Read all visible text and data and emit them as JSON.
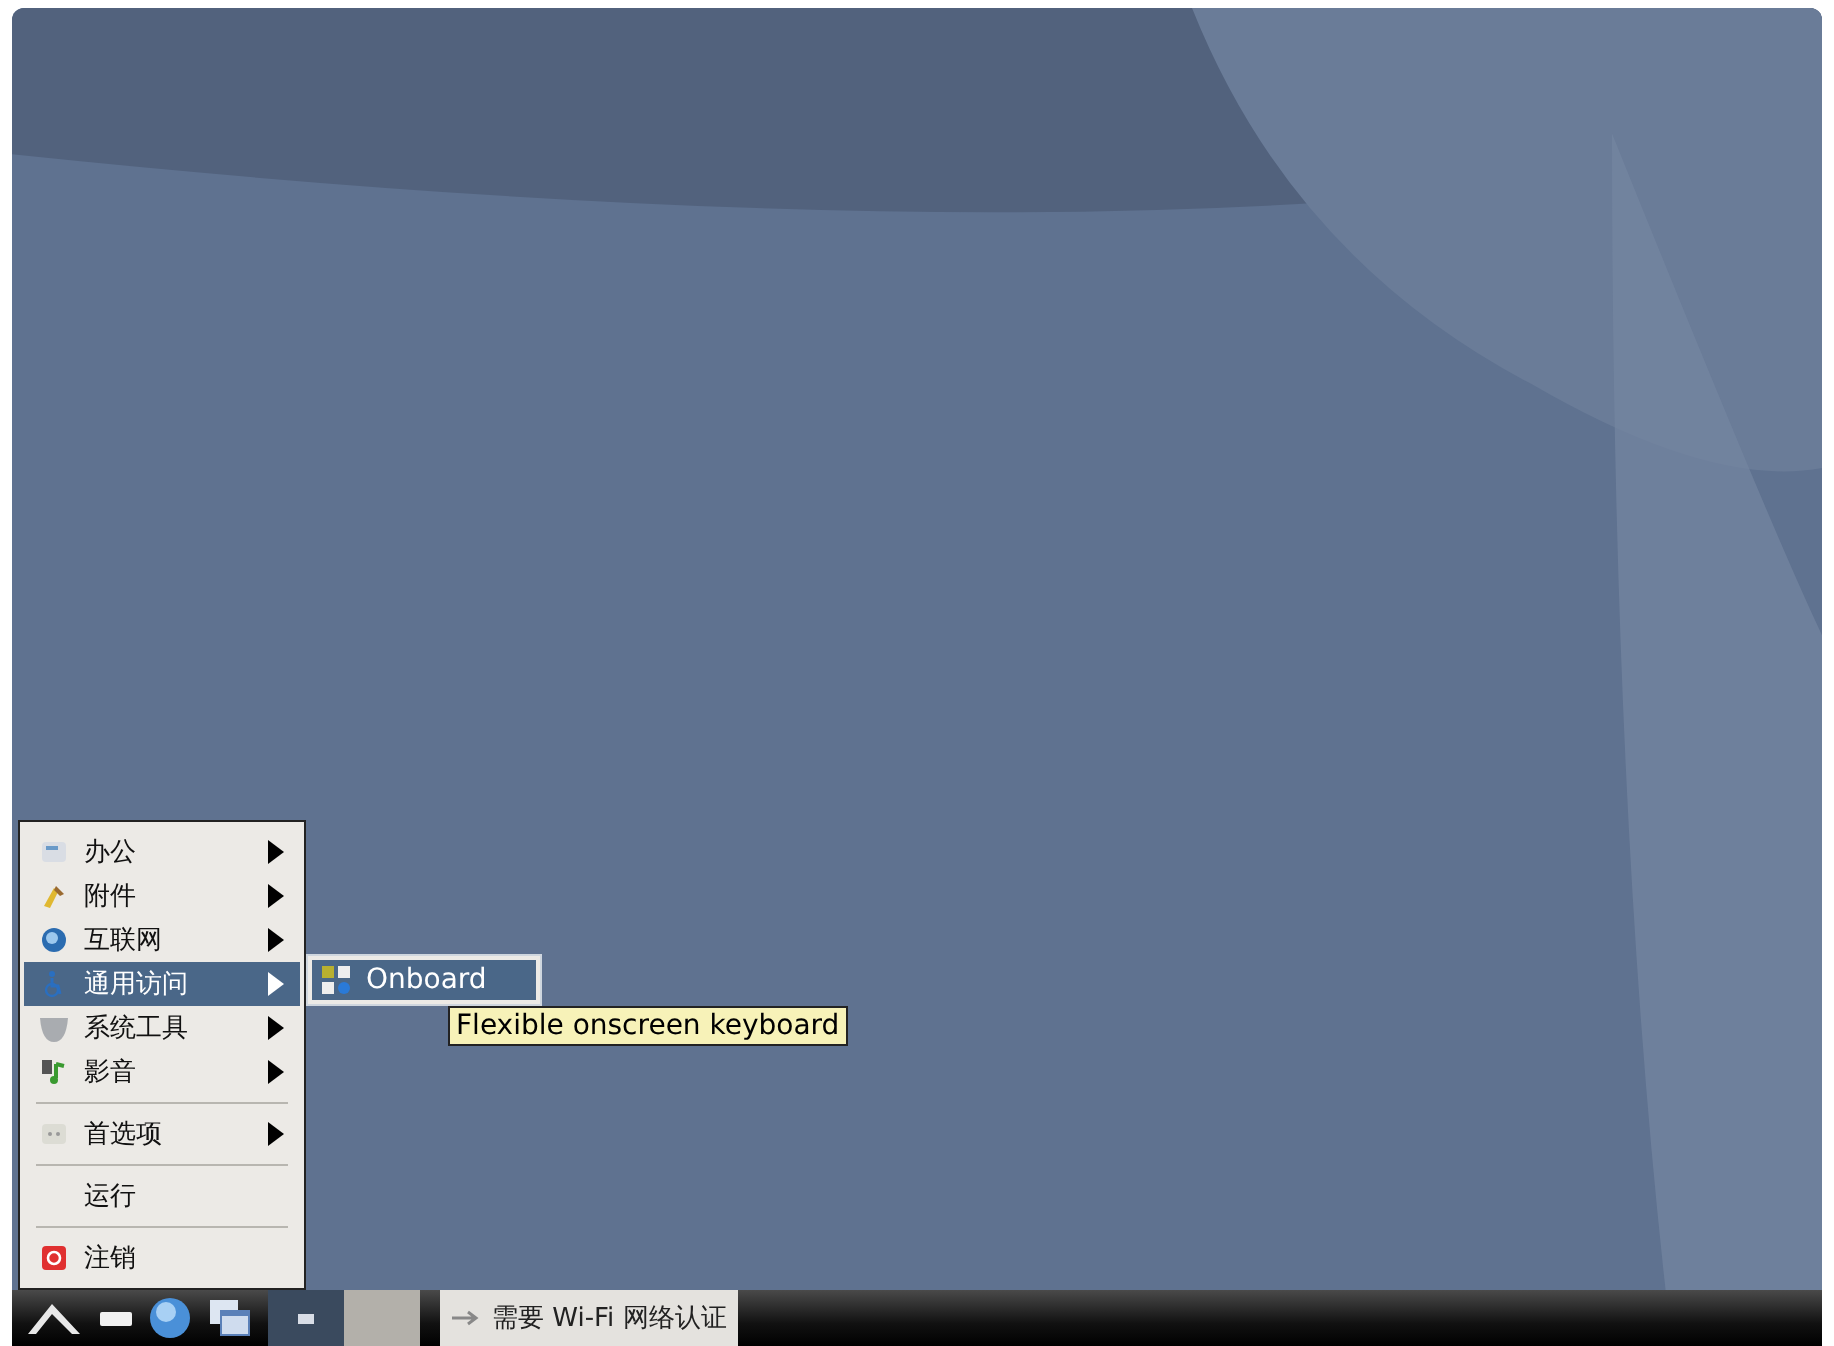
{
  "menu": {
    "items": [
      {
        "kind": "entry",
        "label": "办公",
        "submenu": true,
        "selected": false
      },
      {
        "kind": "entry",
        "label": "附件",
        "submenu": true,
        "selected": false
      },
      {
        "kind": "entry",
        "label": "互联网",
        "submenu": true,
        "selected": false
      },
      {
        "kind": "entry",
        "label": "通用访问",
        "submenu": true,
        "selected": true
      },
      {
        "kind": "entry",
        "label": "系统工具",
        "submenu": true,
        "selected": false
      },
      {
        "kind": "entry",
        "label": "影音",
        "submenu": true,
        "selected": false
      },
      {
        "kind": "separator"
      },
      {
        "kind": "entry",
        "label": "首选项",
        "submenu": true,
        "selected": false
      },
      {
        "kind": "separator"
      },
      {
        "kind": "entry",
        "label": "运行",
        "submenu": false,
        "selected": false
      },
      {
        "kind": "separator"
      },
      {
        "kind": "entry",
        "label": "注销",
        "submenu": false,
        "selected": false
      }
    ]
  },
  "submenu": {
    "items": [
      {
        "label": "Onboard",
        "selected": true
      }
    ]
  },
  "tooltip": "Flexible onscreen keyboard",
  "taskbar": {
    "desktops": [
      {
        "selected": true
      },
      {
        "selected": false
      }
    ],
    "notification": "需要 Wi-Fi 网络认证"
  }
}
